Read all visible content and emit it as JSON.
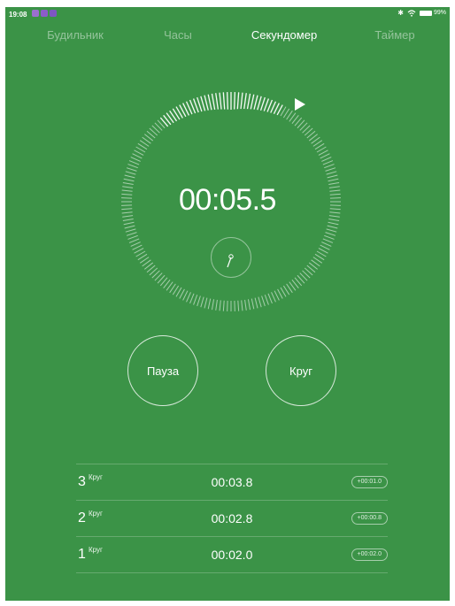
{
  "status_bar": {
    "time": "19:08",
    "battery": "99%"
  },
  "tabs": [
    {
      "label": "Будильник",
      "active": false
    },
    {
      "label": "Часы",
      "active": false
    },
    {
      "label": "Секундомер",
      "active": true
    },
    {
      "label": "Таймер",
      "active": false
    }
  ],
  "stopwatch": {
    "time": "00:05.5"
  },
  "buttons": {
    "pause": "Пауза",
    "lap": "Круг"
  },
  "laps": [
    {
      "num": "3",
      "word": "Круг",
      "time": "00:03.8",
      "diff": "+00:01.0"
    },
    {
      "num": "2",
      "word": "Круг",
      "time": "00:02.8",
      "diff": "+00:00.8"
    },
    {
      "num": "1",
      "word": "Круг",
      "time": "00:02.0",
      "diff": "+00:02.0"
    }
  ],
  "colors": {
    "background": "#3b9347",
    "foreground": "#ffffff"
  }
}
